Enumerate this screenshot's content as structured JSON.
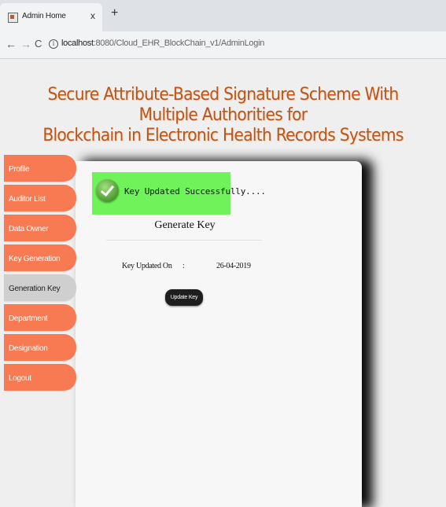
{
  "browser": {
    "tab_title": "Admin Home",
    "tab_close": "x",
    "new_tab": "+",
    "back": "←",
    "forward": "→",
    "reload": "C",
    "info_icon": "i",
    "url_host": "localhost",
    "url_rest": ":8080/Cloud_EHR_BlockChain_v1/AdminLogin"
  },
  "header": {
    "title_line1": "Secure Attribute-Based Signature Scheme With Multiple Authorities for",
    "title_line2": "Blockchain in Electronic Health Records Systems",
    "title_color": "#b8561f"
  },
  "sidebar": {
    "items": [
      {
        "label": "Profile"
      },
      {
        "label": "Auditor List"
      },
      {
        "label": "Data Owner"
      },
      {
        "label": "Key Generation"
      },
      {
        "label": "Generation Key"
      },
      {
        "label": "Department"
      },
      {
        "label": "Designation"
      },
      {
        "label": "Logout"
      }
    ],
    "active_index": 4,
    "item_color": "#f77a52",
    "active_color": "#cfcfcf"
  },
  "main": {
    "success_message": "Key  Updated  Successfully....",
    "success_color": "#6ff25a",
    "section_title": "Generate Key",
    "key_label": "Key Updated On",
    "separator": ":",
    "key_date": "26-04-2019",
    "update_button": "Update Key"
  }
}
